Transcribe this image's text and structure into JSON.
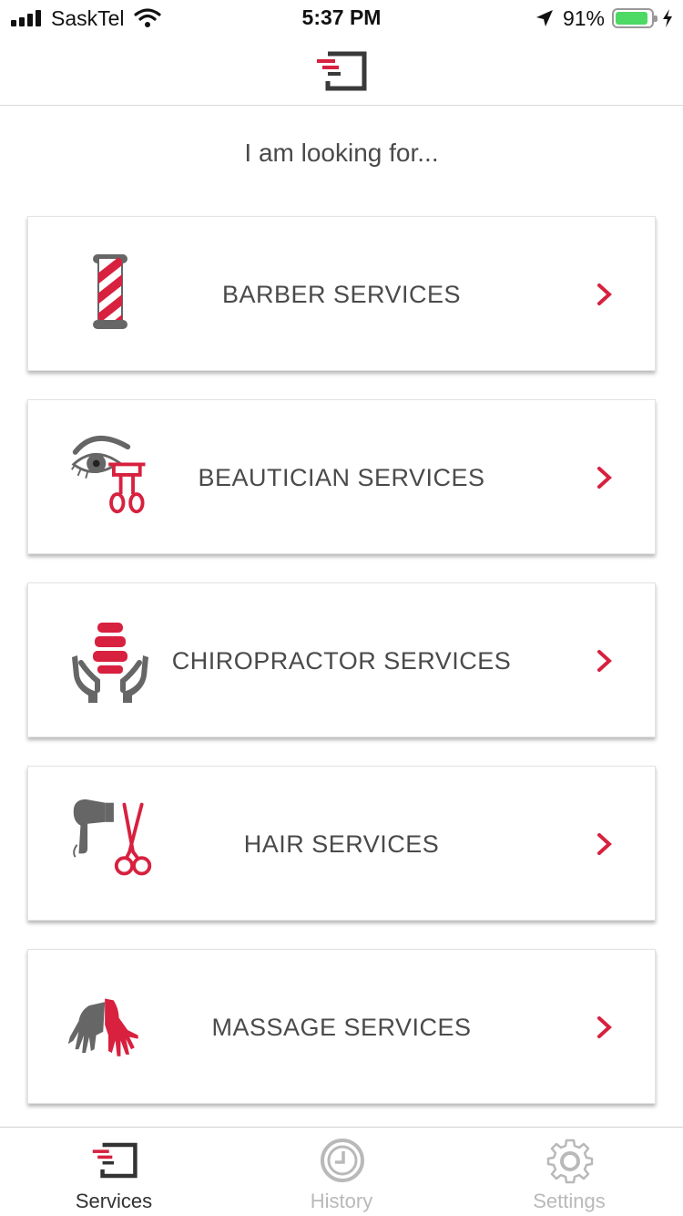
{
  "status_bar": {
    "carrier": "SaskTel",
    "time": "5:37 PM",
    "battery_percent": "91%",
    "battery_level": 0.91,
    "icons": [
      "signal-icon",
      "wifi-icon",
      "location-arrow-icon",
      "battery-icon",
      "charging-bolt-icon"
    ]
  },
  "header": {
    "logo_icon": "app-logo-icon"
  },
  "prompt": "I am looking for...",
  "services": [
    {
      "label": "BARBER SERVICES",
      "icon": "barber-pole-icon"
    },
    {
      "label": "BEAUTICIAN SERVICES",
      "icon": "eyelash-curler-icon"
    },
    {
      "label": "CHIROPRACTOR SERVICES",
      "icon": "spine-hands-icon"
    },
    {
      "label": "HAIR SERVICES",
      "icon": "hairdryer-scissors-icon"
    },
    {
      "label": "MASSAGE SERVICES",
      "icon": "massage-hands-icon"
    }
  ],
  "tabs": [
    {
      "label": "Services",
      "icon": "services-logo-icon",
      "active": true
    },
    {
      "label": "History",
      "icon": "clock-icon",
      "active": false
    },
    {
      "label": "Settings",
      "icon": "gear-icon",
      "active": false
    }
  ],
  "colors": {
    "accent": "#d7213f",
    "icon_gray": "#666666",
    "text": "#4a4a4a",
    "tab_active": "#333333",
    "tab_inactive": "#b9b9b9"
  }
}
